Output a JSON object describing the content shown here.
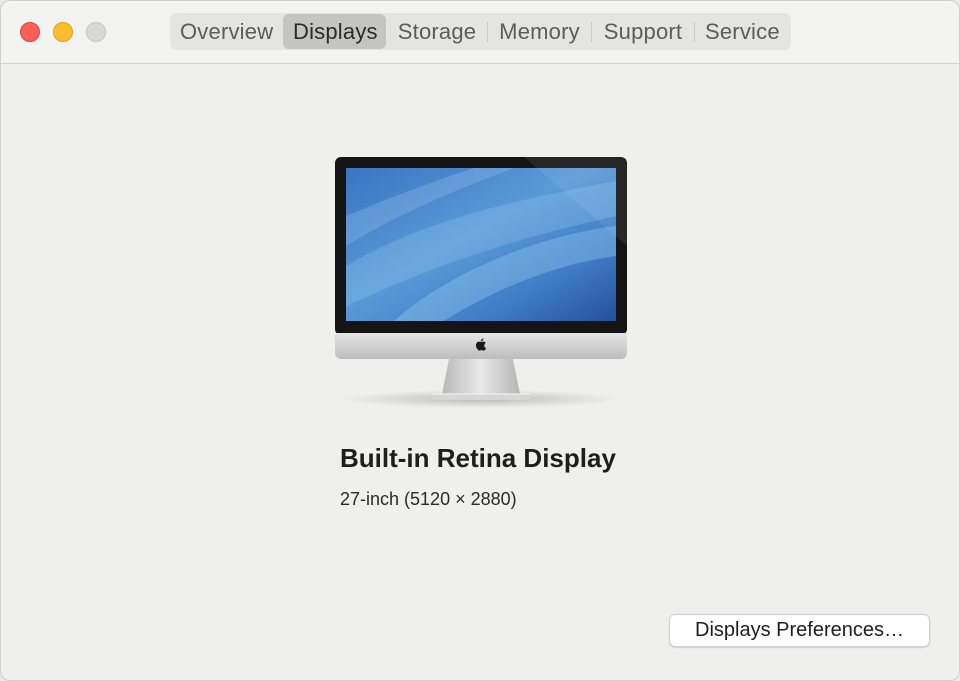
{
  "window": {
    "controls": {
      "close": "close",
      "minimize": "minimize",
      "zoom": "zoom"
    }
  },
  "tabs": [
    {
      "label": "Overview",
      "active": false
    },
    {
      "label": "Displays",
      "active": true
    },
    {
      "label": "Storage",
      "active": false
    },
    {
      "label": "Memory",
      "active": false
    },
    {
      "label": "Support",
      "active": false
    },
    {
      "label": "Service",
      "active": false
    }
  ],
  "display": {
    "name": "Built-in Retina Display",
    "size": "27-inch (5120 × 2880)",
    "icon": "imac-icon"
  },
  "actions": {
    "preferences_label": "Displays Preferences…"
  },
  "colors": {
    "close": "#fd5e57",
    "minimize": "#fdbc2e",
    "zoom_inactive": "#d8d8d8",
    "active_tab": "#c4c4c2"
  }
}
